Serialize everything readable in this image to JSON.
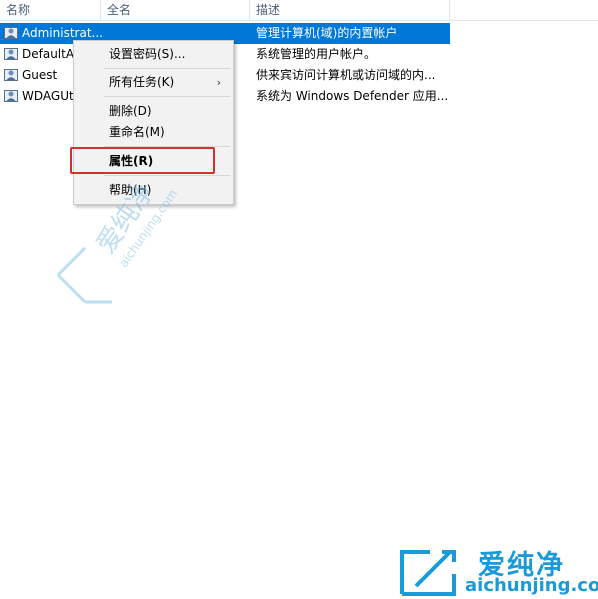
{
  "columns": {
    "name": "名称",
    "fullname": "全名",
    "description": "描述"
  },
  "rows": [
    {
      "name": "Administrat...",
      "description": "管理计算机(域)的内置帐户",
      "selected": true,
      "icon": "user-account-icon"
    },
    {
      "name": "DefaultAc",
      "description": "系统管理的用户帐户。",
      "selected": false,
      "icon": "user-account-icon"
    },
    {
      "name": "Guest",
      "description": "供来宾访问计算机或访问域的内...",
      "selected": false,
      "icon": "user-account-icon"
    },
    {
      "name": "WDAGUt",
      "description": "系统为 Windows Defender 应用...",
      "selected": false,
      "icon": "user-account-icon"
    }
  ],
  "context_menu": {
    "set_password": "设置密码(S)...",
    "all_tasks": "所有任务(K)",
    "all_tasks_arrow": "›",
    "delete": "删除(D)",
    "rename": "重命名(M)",
    "properties": "属性(R)",
    "help": "帮助(H)"
  },
  "watermark": {
    "center_text": "爱纯净",
    "center_url": "aichunjing.com",
    "logo_text": "爱纯净",
    "logo_url": "aichunjing.com"
  },
  "colors": {
    "selection": "#0078d7",
    "highlight_box": "#d0322d",
    "watermark": "#1a9ad9"
  }
}
